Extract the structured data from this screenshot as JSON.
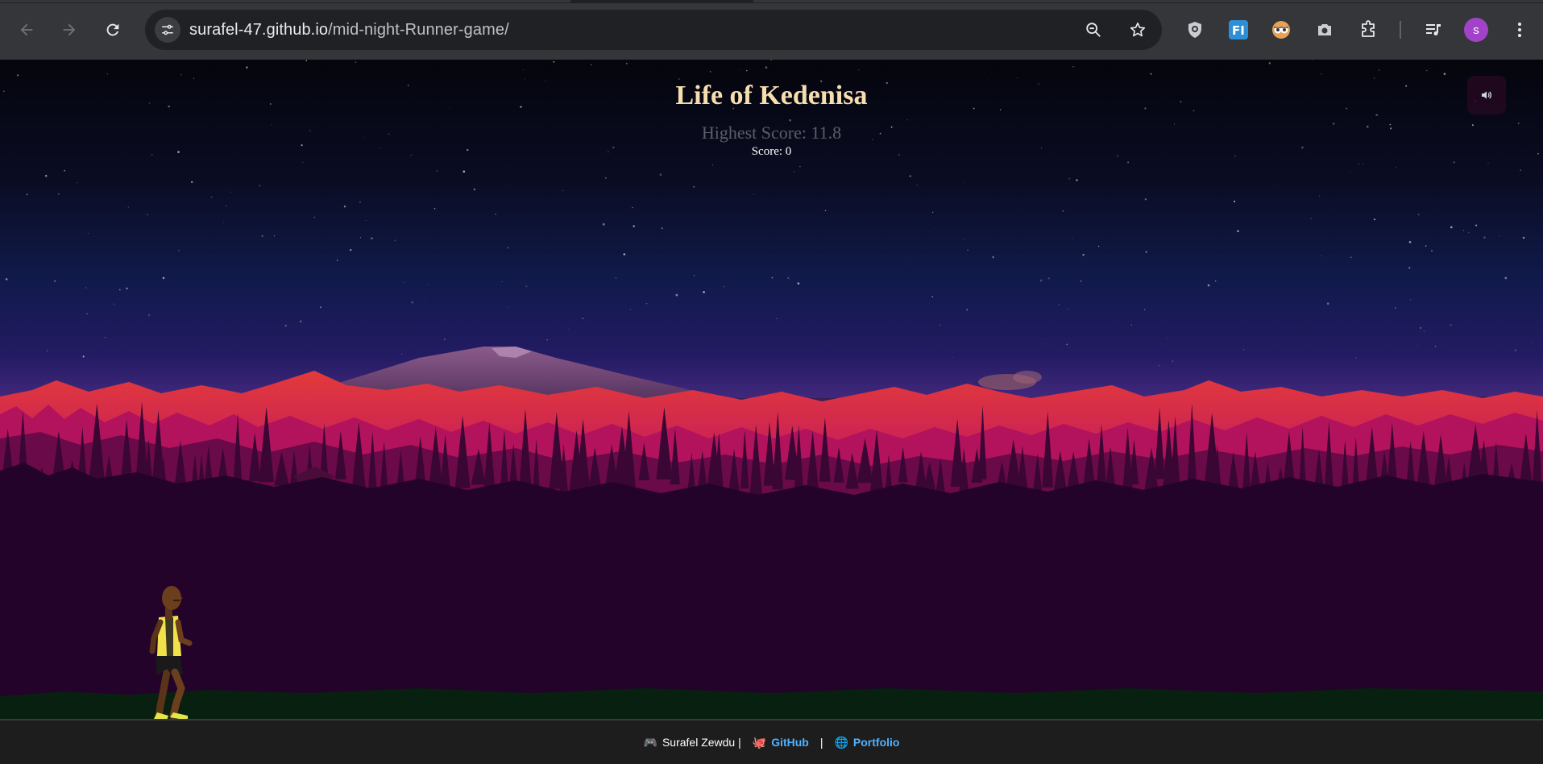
{
  "browser": {
    "url_host": "surafel-47.github.io",
    "url_path": "/mid-night-Runner-game/",
    "profile_initial": "s"
  },
  "game": {
    "title": "Life of Kedenisa",
    "highest_score_label": "Highest Score: 11.8",
    "score_label": "Score: 0",
    "icons": {
      "sound": "speaker-icon",
      "runner": "runner-character"
    }
  },
  "footer": {
    "author_icon": "🎮",
    "author": "Surafel Zewdu |",
    "github_icon": "🐙",
    "github_label": "GitHub",
    "separator": "|",
    "portfolio_icon": "🌐",
    "portfolio_label": "Portfolio"
  },
  "colors": {
    "title": "#f6deae",
    "link": "#4fb3ff",
    "mountain_red": "#e0283f",
    "forest_dark": "#1e0220",
    "ground": "#062012"
  }
}
